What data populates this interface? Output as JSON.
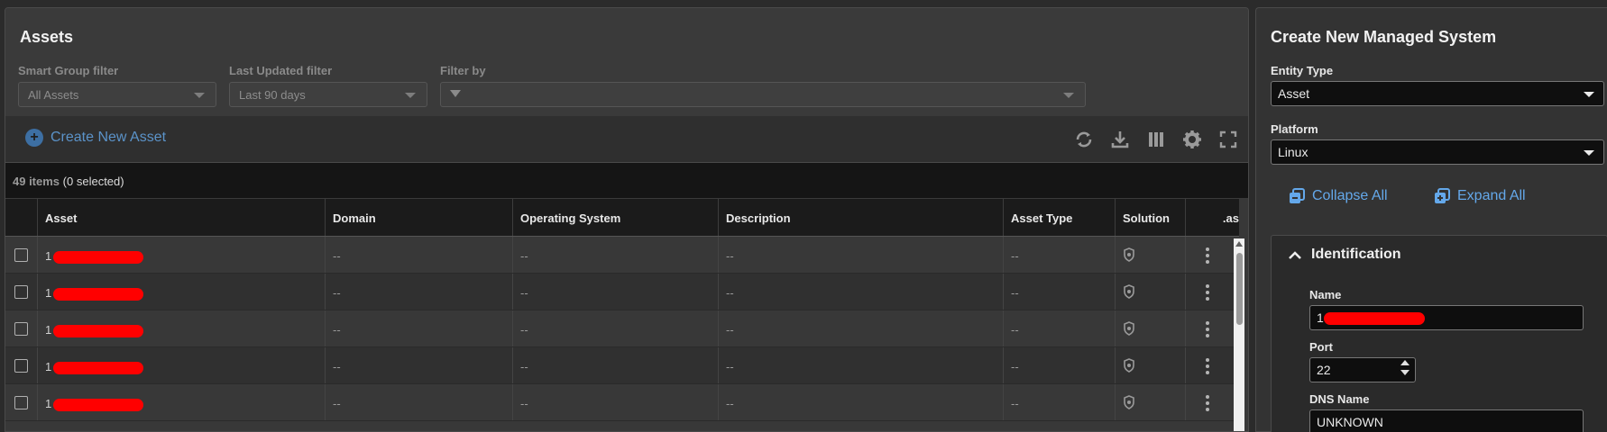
{
  "assets_panel": {
    "title": "Assets",
    "filters": {
      "smart_group": {
        "label": "Smart Group filter",
        "value": "All Assets"
      },
      "last_updated": {
        "label": "Last Updated filter",
        "value": "Last 90 days"
      },
      "filter_by": {
        "label": "Filter by",
        "value": ""
      }
    },
    "toolbar": {
      "create_label": "Create New Asset",
      "icons": [
        "refresh-icon",
        "download-icon",
        "columns-icon",
        "gear-icon",
        "fullscreen-icon"
      ]
    },
    "count": {
      "items": "49 items",
      "selected": "(0 selected)"
    },
    "columns": [
      "Asset",
      "Domain",
      "Operating System",
      "Description",
      "Asset Type",
      "Solution",
      ".as"
    ],
    "rows": [
      {
        "asset_prefix": "1",
        "domain": "--",
        "os": "--",
        "description": "--",
        "asset_type": "--"
      },
      {
        "asset_prefix": "1",
        "domain": "--",
        "os": "--",
        "description": "--",
        "asset_type": "--"
      },
      {
        "asset_prefix": "1",
        "domain": "--",
        "os": "--",
        "description": "--",
        "asset_type": "--"
      },
      {
        "asset_prefix": "1",
        "domain": "--",
        "os": "--",
        "description": "--",
        "asset_type": "--"
      },
      {
        "asset_prefix": "1",
        "domain": "--",
        "os": "--",
        "description": "--",
        "asset_type": "--"
      }
    ]
  },
  "create_panel": {
    "title": "Create New Managed System",
    "entity_type": {
      "label": "Entity Type",
      "value": "Asset"
    },
    "platform": {
      "label": "Platform",
      "value": "Linux"
    },
    "collapse_all": "Collapse All",
    "expand_all": "Expand All",
    "identification": {
      "title": "Identification",
      "name": {
        "label": "Name",
        "value": "1"
      },
      "port": {
        "label": "Port",
        "value": "22"
      },
      "dns_name": {
        "label": "DNS Name",
        "value": "UNKNOWN"
      }
    }
  },
  "colors": {
    "accent_link": "#64a8ea",
    "create_link": "#5b93c9",
    "redaction": "#ff0000"
  }
}
